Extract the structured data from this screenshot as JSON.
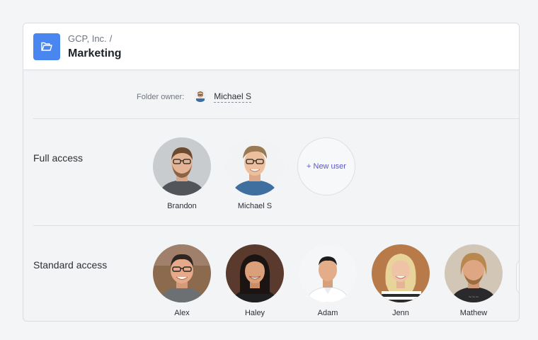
{
  "header": {
    "breadcrumb": "GCP, Inc.",
    "breadcrumb_separator": "/",
    "title": "Marketing",
    "folder_icon": "folder-open-icon",
    "accent": "#4a86f0"
  },
  "owner": {
    "label": "Folder owner:",
    "name": "Michael S"
  },
  "full_access": {
    "label": "Full access",
    "users": [
      {
        "name": "Brandon"
      },
      {
        "name": "Michael S"
      }
    ],
    "new_user_label": "+ New user",
    "new_user_color": "#5b56c9"
  },
  "standard_access": {
    "label": "Standard access",
    "users": [
      {
        "name": "Alex"
      },
      {
        "name": "Haley"
      },
      {
        "name": "Adam"
      },
      {
        "name": "Jenn"
      },
      {
        "name": "Mathew"
      }
    ]
  }
}
